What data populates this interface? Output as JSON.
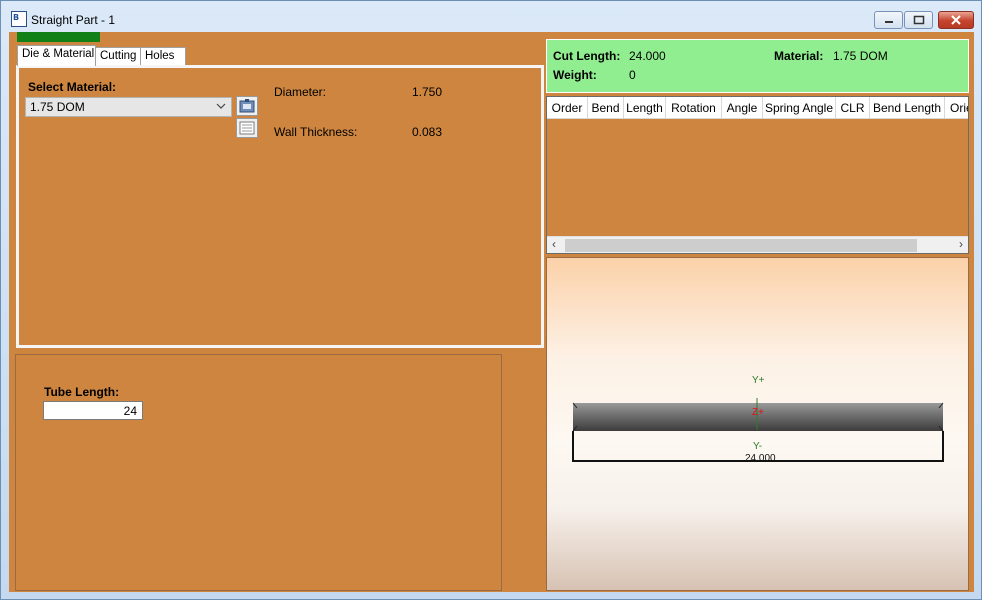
{
  "window": {
    "title": "Straight Part - 1"
  },
  "tabs": [
    {
      "label": "Die & Material"
    },
    {
      "label": "Cutting"
    },
    {
      "label": "Holes"
    }
  ],
  "die_material": {
    "select_label": "Select Material:",
    "material_value": "1.75 DOM",
    "diameter_label": "Diameter:",
    "diameter_value": "1.750",
    "wall_label": "Wall Thickness:",
    "wall_value": "0.083"
  },
  "tube": {
    "label": "Tube Length:",
    "value": "24"
  },
  "info": {
    "cut_length_label": "Cut Length:",
    "cut_length_value": "24.000",
    "material_label": "Material:",
    "material_value": "1.75 DOM",
    "weight_label": "Weight:",
    "weight_value": "0"
  },
  "bend_table": {
    "columns": [
      "Order",
      "Bend",
      "Length",
      "Rotation",
      "Angle",
      "Spring Angle",
      "CLR",
      "Bend Length",
      "Orie"
    ],
    "rows": []
  },
  "viewport": {
    "y_plus": "Y+",
    "z_plus": "Z+",
    "y_minus": "Y-",
    "dimension": "24.000"
  },
  "colors": {
    "panel_bg": "#cd853f",
    "info_bg": "#90ee90",
    "progress": "#118016"
  }
}
